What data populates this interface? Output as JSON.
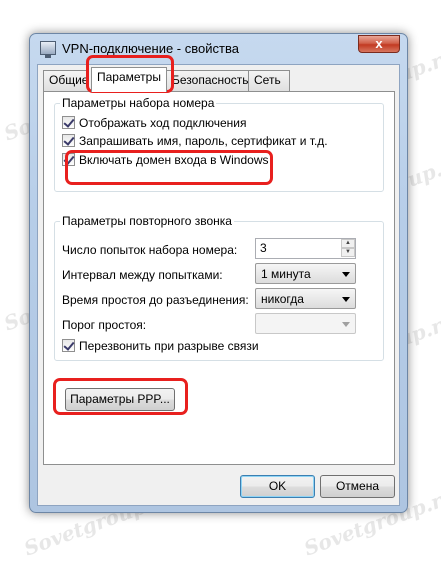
{
  "window": {
    "title": "VPN-подключение - свойства",
    "close_glyph": "x"
  },
  "tabs": [
    {
      "label": "Общие",
      "active": false
    },
    {
      "label": "Параметры",
      "active": true
    },
    {
      "label": "Безопасность",
      "active": false
    },
    {
      "label": "Сеть",
      "active": false
    }
  ],
  "dialing": {
    "legend": "Параметры набора номера",
    "options": [
      {
        "label": "Отображать ход подключения",
        "checked": true
      },
      {
        "label": "Запрашивать имя, пароль, сертификат и т.д.",
        "checked": true
      },
      {
        "label": "Включать домен входа в Windows",
        "checked": true
      }
    ]
  },
  "redial": {
    "legend": "Параметры повторного звонка",
    "attempts_label": "Число попыток набора номера:",
    "attempts_value": "3",
    "interval_label": "Интервал между попытками:",
    "interval_value": "1 минута",
    "idle_label": "Время простоя до разъединения:",
    "idle_value": "никогда",
    "threshold_label": "Порог простоя:",
    "threshold_value": "",
    "redial_on_drop_label": "Перезвонить при разрыве связи",
    "redial_on_drop_checked": true
  },
  "ppp_button": "Параметры PPP...",
  "ok_button": "OK",
  "cancel_button": "Отмена",
  "watermark_text": "Sovetgroup.ru",
  "colors": {
    "highlight": "#e8201e",
    "titlebar": "#b6cde8",
    "close_button": "#c23a22"
  }
}
